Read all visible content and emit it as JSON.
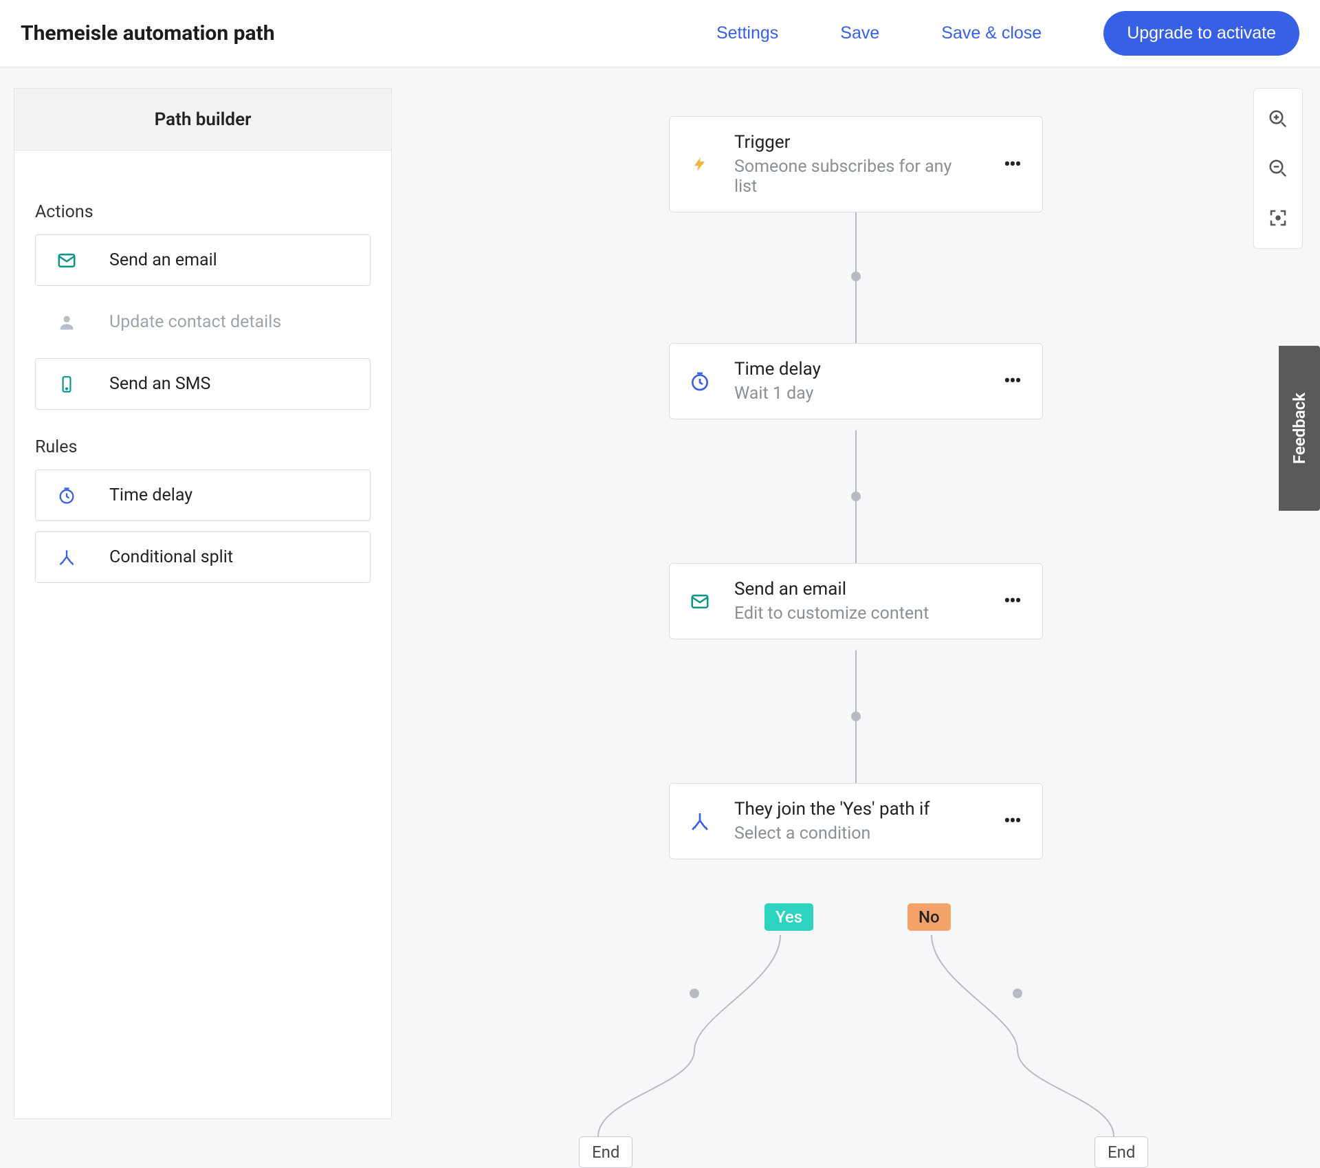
{
  "header": {
    "title": "Themeisle automation path",
    "settings": "Settings",
    "save": "Save",
    "save_close": "Save & close",
    "upgrade": "Upgrade to activate"
  },
  "sidebar": {
    "title": "Path builder",
    "actions_label": "Actions",
    "rules_label": "Rules",
    "actions": [
      {
        "label": "Send an email",
        "icon": "mail-icon",
        "disabled": false
      },
      {
        "label": "Update contact details",
        "icon": "person-icon",
        "disabled": true
      },
      {
        "label": "Send an SMS",
        "icon": "phone-icon",
        "disabled": false
      }
    ],
    "rules": [
      {
        "label": "Time delay",
        "icon": "stopwatch-icon"
      },
      {
        "label": "Conditional split",
        "icon": "split-icon"
      }
    ]
  },
  "flow": {
    "nodes": [
      {
        "title": "Trigger",
        "sub": "Someone subscribes for any list",
        "icon": "bolt-icon",
        "icon_color": "#f3b33b"
      },
      {
        "title": "Time delay",
        "sub": "Wait 1 day",
        "icon": "stopwatch-icon",
        "icon_color": "#3860e4"
      },
      {
        "title": "Send an email",
        "sub": "Edit to customize content",
        "icon": "mail-icon",
        "icon_color": "#0d9488"
      },
      {
        "title": "They join the 'Yes' path if",
        "sub": "Select a condition",
        "icon": "split-icon",
        "icon_color": "#3860e4"
      }
    ],
    "yes_label": "Yes",
    "no_label": "No",
    "end_label": "End"
  },
  "feedback_label": "Feedback"
}
